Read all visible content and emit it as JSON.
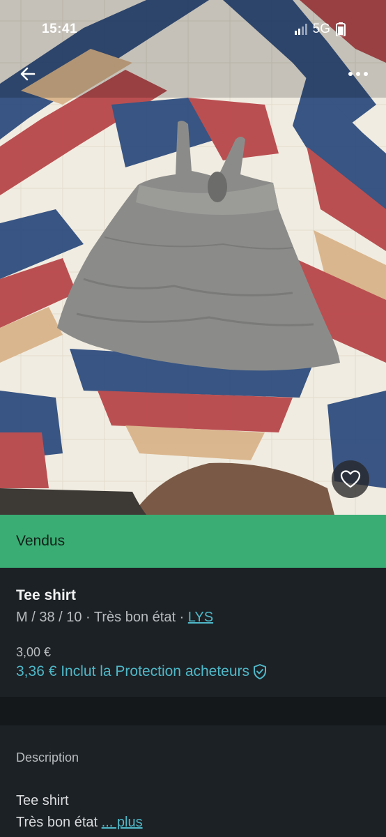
{
  "status_bar": {
    "time": "15:41",
    "network": "5G",
    "icons": [
      "mute-icon",
      "signal-icon",
      "battery-icon"
    ]
  },
  "header": {
    "back_icon": "arrow-left-icon",
    "more_icon": "more-horizontal-icon"
  },
  "photo": {
    "subject": "gray patterned tank top on quilt",
    "favorite_icon": "heart-icon"
  },
  "banner": {
    "label": "Vendus",
    "color": "#3aad74"
  },
  "item": {
    "title": "Tee shirt",
    "meta_prefix": "M / 38 / 10 · Très bon état · ",
    "brand": "LYS",
    "price": "3,00 €",
    "total_price": "3,36 € Inclut la Protection acheteurs",
    "protection_icon": "shield-check-icon"
  },
  "description": {
    "heading": "Description",
    "line1": "Tee shirt",
    "line2": "Très bon état ",
    "more_label": "... plus"
  },
  "colors": {
    "accent": "#4fb8c8",
    "background": "#1c2125",
    "banner": "#3aad74"
  }
}
